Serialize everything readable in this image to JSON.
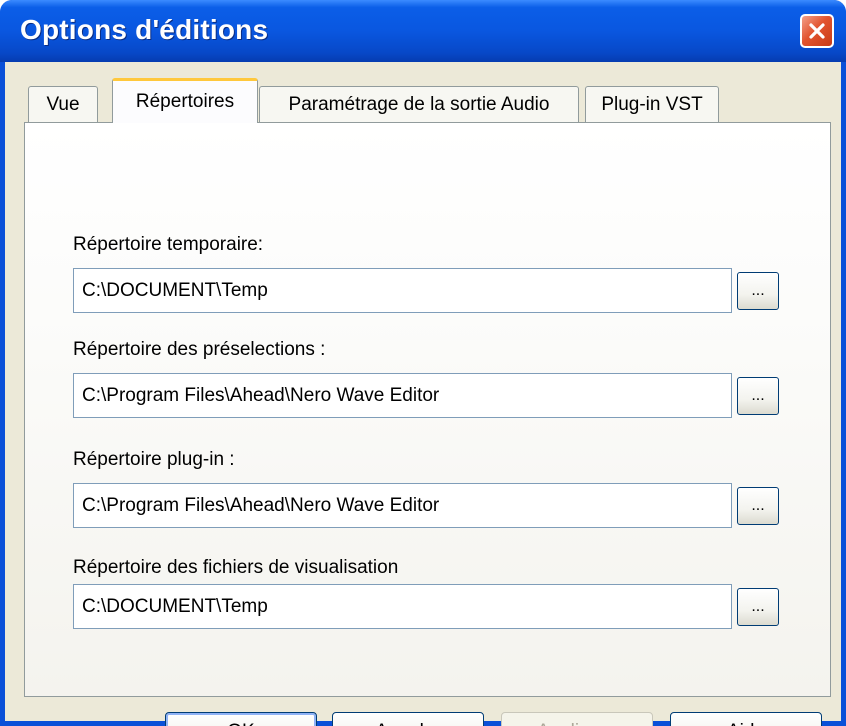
{
  "window": {
    "title": "Options d'éditions",
    "close_glyph": "close-icon"
  },
  "tabs": [
    {
      "label": "Vue",
      "active": false
    },
    {
      "label": "Répertoires",
      "active": true
    },
    {
      "label": "Paramétrage de la sortie Audio",
      "active": false
    },
    {
      "label": "Plug-in VST",
      "active": false
    }
  ],
  "fields": [
    {
      "label": "Répertoire temporaire:",
      "value": "C:\\DOCUMENT\\Temp",
      "browse_label": "..."
    },
    {
      "label": "Répertoire des préselections :",
      "value": "C:\\Program Files\\Ahead\\Nero Wave Editor",
      "browse_label": "..."
    },
    {
      "label": "Répertoire plug-in :",
      "value": "C:\\Program Files\\Ahead\\Nero Wave Editor",
      "browse_label": "..."
    },
    {
      "label": "Répertoire des fichiers de visualisation",
      "value": "C:\\DOCUMENT\\Temp",
      "browse_label": "..."
    }
  ],
  "buttons": {
    "ok": "OK",
    "cancel": "Annuler",
    "apply": "Appliquer",
    "help": "Aide"
  },
  "colors": {
    "title_bar": "#0a57e0",
    "close_button": "#e2542f",
    "client_bg": "#ece9d8",
    "active_tab_accent": "#ffc83c"
  }
}
